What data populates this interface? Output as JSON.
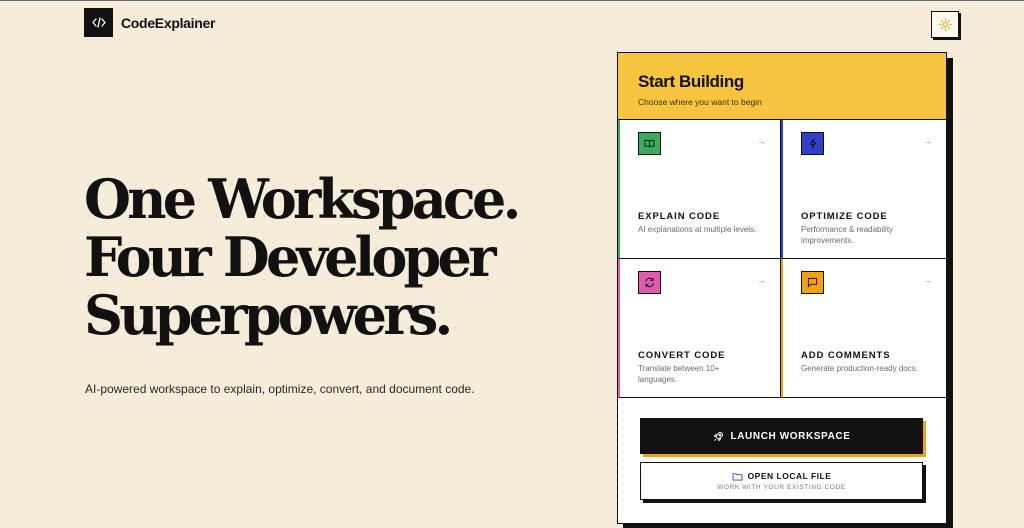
{
  "header": {
    "brand_name": "CodeExplainer",
    "logo_icon": "code-brackets-icon",
    "theme_toggle_icon": "sun-icon"
  },
  "hero": {
    "title_lines": [
      "One Workspace.",
      "Four Developer",
      "Superpowers."
    ],
    "subtitle": "AI-powered workspace to explain, optimize, convert, and document code."
  },
  "card": {
    "title": "Start Building",
    "subtitle": "Choose where you want to begin",
    "options": [
      {
        "title": "EXPLAIN CODE",
        "description": "AI explanations at multiple levels.",
        "icon": "book-icon",
        "color": "#3bac5e",
        "arrow": "→"
      },
      {
        "title": "OPTIMIZE CODE",
        "description": "Performance & readability improvements.",
        "icon": "lightning-icon",
        "color": "#3140c8",
        "arrow": "→"
      },
      {
        "title": "CONVERT CODE",
        "description": "Translate between 10+ languages.",
        "icon": "refresh-icon",
        "color": "#e05ab0",
        "arrow": "→"
      },
      {
        "title": "ADD COMMENTS",
        "description": "Generate production-ready docs.",
        "icon": "comment-icon",
        "color": "#f2a10f",
        "arrow": "→"
      }
    ],
    "launch_button": {
      "label": "LAUNCH WORKSPACE",
      "icon": "rocket-icon"
    },
    "open_button": {
      "label": "OPEN LOCAL FILE",
      "sublabel": "WORK WITH YOUR EXISTING CODE",
      "icon": "folder-icon"
    }
  },
  "colors": {
    "background": "#f5ecd9",
    "accent_yellow": "#f7c43f",
    "ink": "#111111"
  }
}
